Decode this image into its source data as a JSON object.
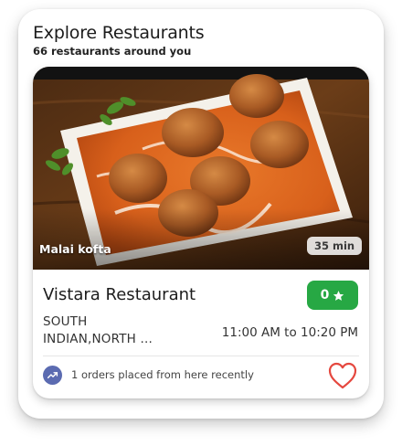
{
  "header": {
    "title": "Explore Restaurants",
    "subtitle": "66 restaurants around you"
  },
  "restaurant": {
    "dish_name": "Malai kofta",
    "delivery_time": "35 min",
    "name": "Vistara Restaurant",
    "rating": "0",
    "rating_icon": "star-icon",
    "cuisine_line1": "SOUTH",
    "cuisine_line2": "INDIAN,NORTH ...",
    "hours": "11:00 AM to 10:20 PM",
    "orders_note": "1 orders placed from here recently",
    "orders_icon": "trending-up-icon",
    "favorite_icon": "heart-outline-icon"
  },
  "colors": {
    "rating_green": "#27a844",
    "heart_red": "#e5483f",
    "trend_icon_bg": "#5b6bb1"
  }
}
